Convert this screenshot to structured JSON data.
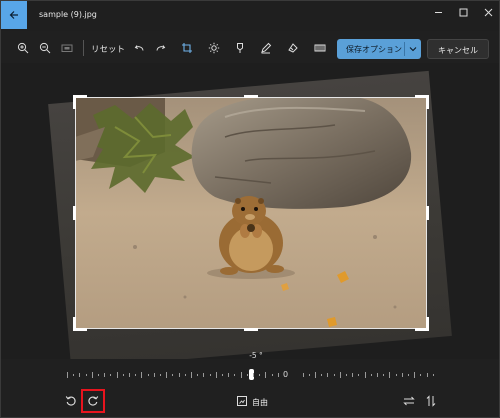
{
  "window": {
    "title": "sample (9).jpg",
    "icons": {
      "back": "back-arrow-icon",
      "minimize": "minimize-icon",
      "maximize": "maximize-icon",
      "close": "close-icon"
    }
  },
  "toolbar": {
    "reset_label": "リセット",
    "save_label": "保存オプション",
    "cancel_label": "キャンセル",
    "icons": [
      "zoom-in-icon",
      "zoom-out-icon",
      "fit-icon",
      "undo-icon",
      "redo-icon",
      "crop-icon",
      "brightness-icon",
      "filter-icon",
      "markup-icon",
      "retouch-icon",
      "red-eye-icon",
      "save-dropdown-chevron-icon"
    ]
  },
  "editor": {
    "angle_label": "-5 °",
    "angle_value": -5,
    "ruler_zero_label": "0",
    "aspect_label": "自由"
  },
  "bottom_bar": {
    "icons": [
      "rotate-left-icon",
      "rotate-right-icon",
      "aspect-ratio-icon",
      "flip-horizontal-icon",
      "flip-vertical-icon"
    ]
  },
  "colors": {
    "accent": "#5aa0d8",
    "back_button": "#58a6e8",
    "background": "#202020",
    "highlight": "#e8141e"
  }
}
